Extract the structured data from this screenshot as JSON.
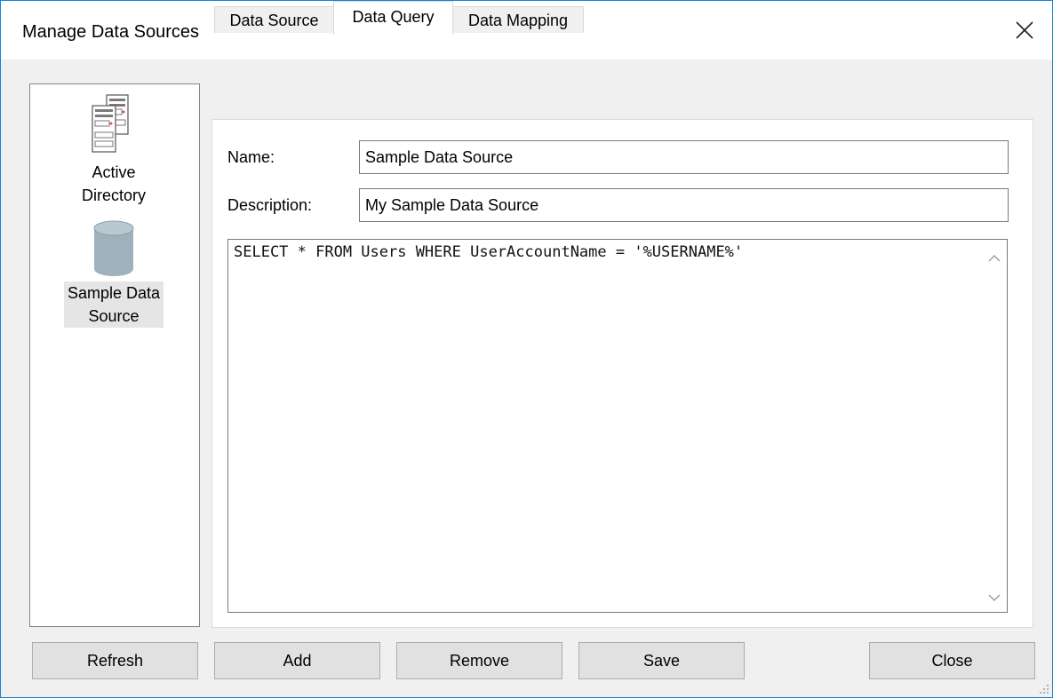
{
  "window": {
    "title": "Manage Data Sources",
    "close_icon": "close-icon"
  },
  "sources": [
    {
      "label_line1": "Active",
      "label_line2": "Directory",
      "icon": "server-icon",
      "selected": false
    },
    {
      "label_line1": "Sample Data",
      "label_line2": "Source",
      "icon": "database-icon",
      "selected": true
    }
  ],
  "tabs": [
    {
      "label": "Data Source",
      "active": false
    },
    {
      "label": "Data Query",
      "active": true
    },
    {
      "label": "Data Mapping",
      "active": false
    }
  ],
  "form": {
    "name_label": "Name:",
    "name_value": "Sample Data Source",
    "description_label": "Description:",
    "description_value": "My Sample Data Source",
    "query_value": "SELECT * FROM Users WHERE UserAccountName = '%USERNAME%'"
  },
  "buttons": {
    "refresh": "Refresh",
    "add": "Add",
    "remove": "Remove",
    "save": "Save",
    "close": "Close"
  },
  "colors": {
    "window_border": "#1883d7",
    "dialog_bg": "#f0f0f0",
    "button_bg": "#e1e1e1",
    "selection_bg": "#e5e5e5",
    "database_icon": "#9fb2bc"
  }
}
